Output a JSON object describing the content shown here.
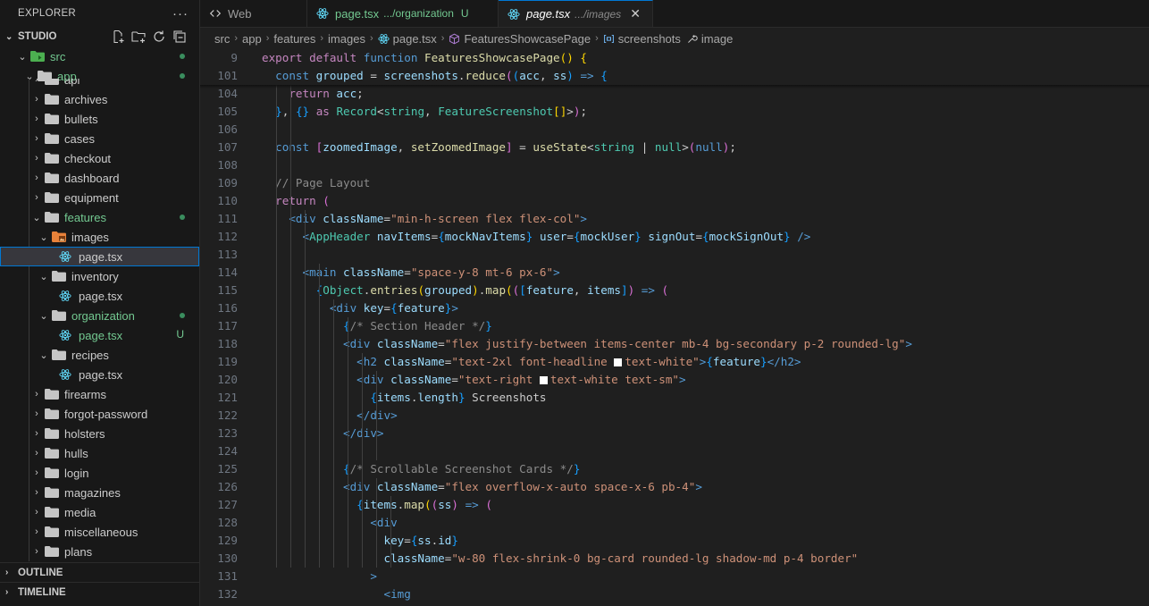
{
  "explorer": {
    "title": "EXPLORER",
    "more": "···",
    "root": "STUDIO",
    "root_actions": [
      "new-file-icon",
      "new-folder-icon",
      "refresh-icon",
      "collapse-all-icon"
    ],
    "src": "src",
    "app": "app",
    "items": [
      {
        "label": "api"
      },
      {
        "label": "archives"
      },
      {
        "label": "bullets"
      },
      {
        "label": "cases"
      },
      {
        "label": "checkout"
      },
      {
        "label": "dashboard"
      },
      {
        "label": "equipment"
      },
      {
        "label": "features"
      },
      {
        "label": "images"
      },
      {
        "label": "page.tsx"
      },
      {
        "label": "inventory"
      },
      {
        "label": "page.tsx"
      },
      {
        "label": "organization"
      },
      {
        "label": "page.tsx",
        "badge": "U"
      },
      {
        "label": "recipes"
      },
      {
        "label": "page.tsx"
      },
      {
        "label": "firearms"
      },
      {
        "label": "forgot-password"
      },
      {
        "label": "holsters"
      },
      {
        "label": "hulls"
      },
      {
        "label": "login"
      },
      {
        "label": "magazines"
      },
      {
        "label": "media"
      },
      {
        "label": "miscellaneous"
      },
      {
        "label": "plans"
      }
    ],
    "outline": "OUTLINE",
    "timeline": "TIMELINE"
  },
  "tabs": [
    {
      "name": "Web",
      "icon": "code-brackets-icon"
    },
    {
      "name": "page.tsx",
      "desc": ".../organization",
      "badge": "U"
    },
    {
      "name": "page.tsx",
      "desc": ".../images",
      "close": "✕"
    }
  ],
  "breadcrumb": [
    "src",
    "app",
    "features",
    "images",
    "page.tsx",
    "FeaturesShowcasePage",
    "screenshots",
    "image"
  ],
  "colors": {
    "accent": "#0078d4",
    "git_untracked": "#73c991",
    "editor_bg": "#1f1f1f",
    "sidebar_bg": "#181818"
  },
  "editor": {
    "sticky": [
      {
        "n": "9",
        "t": [
          [
            "kw",
            "export "
          ],
          [
            "kw",
            "default "
          ],
          [
            "kb",
            "function "
          ],
          [
            "fn",
            "FeaturesShowcasePage"
          ],
          [
            "br1",
            "()"
          ],
          [
            "pu",
            " "
          ],
          [
            "br1",
            "{"
          ]
        ]
      },
      {
        "n": "101",
        "t": [
          [
            "pu",
            "  "
          ],
          [
            "kb",
            "const "
          ],
          [
            "var",
            "grouped"
          ],
          [
            "pu",
            " = "
          ],
          [
            "var",
            "screenshots"
          ],
          [
            "pu",
            "."
          ],
          [
            "fn",
            "reduce"
          ],
          [
            "br2",
            "("
          ],
          [
            "br3",
            "("
          ],
          [
            "var",
            "acc"
          ],
          [
            "pu",
            ", "
          ],
          [
            "var",
            "ss"
          ],
          [
            "br3",
            ")"
          ],
          [
            "pu",
            " "
          ],
          [
            "kb",
            "=>"
          ],
          [
            "pu",
            " "
          ],
          [
            "br3",
            "{"
          ]
        ]
      }
    ],
    "lines": [
      {
        "n": "104",
        "t": [
          [
            "pu",
            "    "
          ],
          [
            "kw",
            "return "
          ],
          [
            "var",
            "acc"
          ],
          [
            "pu",
            ";"
          ]
        ]
      },
      {
        "n": "105",
        "t": [
          [
            "pu",
            "  "
          ],
          [
            "br3",
            "}"
          ],
          [
            "pu",
            ", "
          ],
          [
            "br3",
            "{}"
          ],
          [
            "pu",
            " "
          ],
          [
            "kw",
            "as "
          ],
          [
            "ty",
            "Record"
          ],
          [
            "pu",
            "<"
          ],
          [
            "ty",
            "string"
          ],
          [
            "pu",
            ", "
          ],
          [
            "ty",
            "FeatureScreenshot"
          ],
          [
            "br1",
            "[]"
          ],
          [
            "pu",
            ">"
          ],
          [
            "br2",
            ")"
          ],
          [
            "pu",
            ";"
          ]
        ]
      },
      {
        "n": "106",
        "t": []
      },
      {
        "n": "107",
        "t": [
          [
            "pu",
            "  "
          ],
          [
            "kb",
            "const "
          ],
          [
            "br2",
            "["
          ],
          [
            "var",
            "zoomedImage"
          ],
          [
            "pu",
            ", "
          ],
          [
            "fn",
            "setZoomedImage"
          ],
          [
            "br2",
            "]"
          ],
          [
            "pu",
            " = "
          ],
          [
            "fn",
            "useState"
          ],
          [
            "pu",
            "<"
          ],
          [
            "ty",
            "string"
          ],
          [
            "pu",
            " | "
          ],
          [
            "ty",
            "null"
          ],
          [
            "pu",
            ">"
          ],
          [
            "br2",
            "("
          ],
          [
            "kb",
            "null"
          ],
          [
            "br2",
            ")"
          ],
          [
            "pu",
            ";"
          ]
        ]
      },
      {
        "n": "108",
        "t": []
      },
      {
        "n": "109",
        "t": [
          [
            "pu",
            "  "
          ],
          [
            "cmG",
            "// Page Layout"
          ]
        ]
      },
      {
        "n": "110",
        "t": [
          [
            "pu",
            "  "
          ],
          [
            "kw",
            "return "
          ],
          [
            "br2",
            "("
          ]
        ]
      },
      {
        "n": "111",
        "t": [
          [
            "pu",
            "    "
          ],
          [
            "tag",
            "<div "
          ],
          [
            "attr",
            "className"
          ],
          [
            "pu",
            "="
          ],
          [
            "str",
            "\"min-h-screen flex flex-col\""
          ],
          [
            "tag",
            ">"
          ]
        ]
      },
      {
        "n": "112",
        "t": [
          [
            "pu",
            "      "
          ],
          [
            "tag",
            "<"
          ],
          [
            "cmp",
            "AppHeader "
          ],
          [
            "attr",
            "navItems"
          ],
          [
            "pu",
            "="
          ],
          [
            "br3",
            "{"
          ],
          [
            "var",
            "mockNavItems"
          ],
          [
            "br3",
            "}"
          ],
          [
            "pu",
            " "
          ],
          [
            "attr",
            "user"
          ],
          [
            "pu",
            "="
          ],
          [
            "br3",
            "{"
          ],
          [
            "var",
            "mockUser"
          ],
          [
            "br3",
            "}"
          ],
          [
            "pu",
            " "
          ],
          [
            "attr",
            "signOut"
          ],
          [
            "pu",
            "="
          ],
          [
            "br3",
            "{"
          ],
          [
            "var",
            "mockSignOut"
          ],
          [
            "br3",
            "}"
          ],
          [
            "pu",
            " "
          ],
          [
            "tag",
            "/>"
          ]
        ]
      },
      {
        "n": "113",
        "t": []
      },
      {
        "n": "114",
        "t": [
          [
            "pu",
            "      "
          ],
          [
            "tag",
            "<main "
          ],
          [
            "attr",
            "className"
          ],
          [
            "pu",
            "="
          ],
          [
            "str",
            "\"space-y-8 mt-6 px-6\""
          ],
          [
            "tag",
            ">"
          ]
        ]
      },
      {
        "n": "115",
        "t": [
          [
            "pu",
            "        "
          ],
          [
            "br3",
            "{"
          ],
          [
            "ty",
            "Object"
          ],
          [
            "pu",
            "."
          ],
          [
            "fn",
            "entries"
          ],
          [
            "br1",
            "("
          ],
          [
            "var",
            "grouped"
          ],
          [
            "br1",
            ")"
          ],
          [
            "pu",
            "."
          ],
          [
            "fn",
            "map"
          ],
          [
            "br1",
            "("
          ],
          [
            "br2",
            "("
          ],
          [
            "br3",
            "["
          ],
          [
            "var",
            "feature"
          ],
          [
            "pu",
            ", "
          ],
          [
            "var",
            "items"
          ],
          [
            "br3",
            "]"
          ],
          [
            "br2",
            ")"
          ],
          [
            "pu",
            " "
          ],
          [
            "kb",
            "=>"
          ],
          [
            "pu",
            " "
          ],
          [
            "br2",
            "("
          ]
        ]
      },
      {
        "n": "116",
        "t": [
          [
            "pu",
            "          "
          ],
          [
            "tag",
            "<div "
          ],
          [
            "attr",
            "key"
          ],
          [
            "pu",
            "="
          ],
          [
            "br3",
            "{"
          ],
          [
            "var",
            "feature"
          ],
          [
            "br3",
            "}"
          ],
          [
            "tag",
            ">"
          ]
        ]
      },
      {
        "n": "117",
        "t": [
          [
            "pu",
            "            "
          ],
          [
            "br3",
            "{"
          ],
          [
            "cmG",
            "/* Section Header */"
          ],
          [
            "br3",
            "}"
          ]
        ]
      },
      {
        "n": "118",
        "t": [
          [
            "pu",
            "            "
          ],
          [
            "tag",
            "<div "
          ],
          [
            "attr",
            "className"
          ],
          [
            "pu",
            "="
          ],
          [
            "str",
            "\"flex justify-between items-center mb-4 bg-secondary p-2 rounded-lg\""
          ],
          [
            "tag",
            ">"
          ]
        ]
      },
      {
        "n": "119",
        "t": [
          [
            "pu",
            "              "
          ],
          [
            "tag",
            "<h2 "
          ],
          [
            "attr",
            "className"
          ],
          [
            "pu",
            "="
          ],
          [
            "str",
            "\"text-2xl font-headline "
          ],
          [
            "sw",
            ""
          ],
          [
            "str",
            "text-white\""
          ],
          [
            "tag",
            ">"
          ],
          [
            "br3",
            "{"
          ],
          [
            "var",
            "feature"
          ],
          [
            "br3",
            "}"
          ],
          [
            "tag",
            "</h2>"
          ]
        ]
      },
      {
        "n": "120",
        "t": [
          [
            "pu",
            "              "
          ],
          [
            "tag",
            "<div "
          ],
          [
            "attr",
            "className"
          ],
          [
            "pu",
            "="
          ],
          [
            "str",
            "\"text-right "
          ],
          [
            "sw",
            ""
          ],
          [
            "str",
            "text-white text-sm\""
          ],
          [
            "tag",
            ">"
          ]
        ]
      },
      {
        "n": "121",
        "t": [
          [
            "pu",
            "                "
          ],
          [
            "br3",
            "{"
          ],
          [
            "var",
            "items"
          ],
          [
            "pu",
            "."
          ],
          [
            "var",
            "length"
          ],
          [
            "br3",
            "}"
          ],
          [
            "pu",
            " Screenshots"
          ]
        ]
      },
      {
        "n": "122",
        "t": [
          [
            "pu",
            "              "
          ],
          [
            "tag",
            "</div>"
          ]
        ]
      },
      {
        "n": "123",
        "t": [
          [
            "pu",
            "            "
          ],
          [
            "tag",
            "</div>"
          ]
        ]
      },
      {
        "n": "124",
        "t": []
      },
      {
        "n": "125",
        "t": [
          [
            "pu",
            "            "
          ],
          [
            "br3",
            "{"
          ],
          [
            "cmG",
            "/* Scrollable Screenshot Cards */"
          ],
          [
            "br3",
            "}"
          ]
        ]
      },
      {
        "n": "126",
        "t": [
          [
            "pu",
            "            "
          ],
          [
            "tag",
            "<div "
          ],
          [
            "attr",
            "className"
          ],
          [
            "pu",
            "="
          ],
          [
            "str",
            "\"flex overflow-x-auto space-x-6 pb-4\""
          ],
          [
            "tag",
            ">"
          ]
        ]
      },
      {
        "n": "127",
        "t": [
          [
            "pu",
            "              "
          ],
          [
            "br3",
            "{"
          ],
          [
            "var",
            "items"
          ],
          [
            "pu",
            "."
          ],
          [
            "fn",
            "map"
          ],
          [
            "br1",
            "("
          ],
          [
            "br2",
            "("
          ],
          [
            "var",
            "ss"
          ],
          [
            "br2",
            ")"
          ],
          [
            "pu",
            " "
          ],
          [
            "kb",
            "=>"
          ],
          [
            "pu",
            " "
          ],
          [
            "br2",
            "("
          ]
        ]
      },
      {
        "n": "128",
        "t": [
          [
            "pu",
            "                "
          ],
          [
            "tag",
            "<div"
          ]
        ]
      },
      {
        "n": "129",
        "t": [
          [
            "pu",
            "                  "
          ],
          [
            "attr",
            "key"
          ],
          [
            "pu",
            "="
          ],
          [
            "br3",
            "{"
          ],
          [
            "var",
            "ss"
          ],
          [
            "pu",
            "."
          ],
          [
            "var",
            "id"
          ],
          [
            "br3",
            "}"
          ]
        ]
      },
      {
        "n": "130",
        "t": [
          [
            "pu",
            "                  "
          ],
          [
            "attr",
            "className"
          ],
          [
            "pu",
            "="
          ],
          [
            "str",
            "\"w-80 flex-shrink-0 bg-card rounded-lg shadow-md p-4 border\""
          ]
        ]
      },
      {
        "n": "131",
        "t": [
          [
            "pu",
            "                "
          ],
          [
            "tag",
            ">"
          ]
        ]
      },
      {
        "n": "132",
        "t": [
          [
            "pu",
            "                  "
          ],
          [
            "tag",
            "<img"
          ]
        ]
      }
    ]
  }
}
